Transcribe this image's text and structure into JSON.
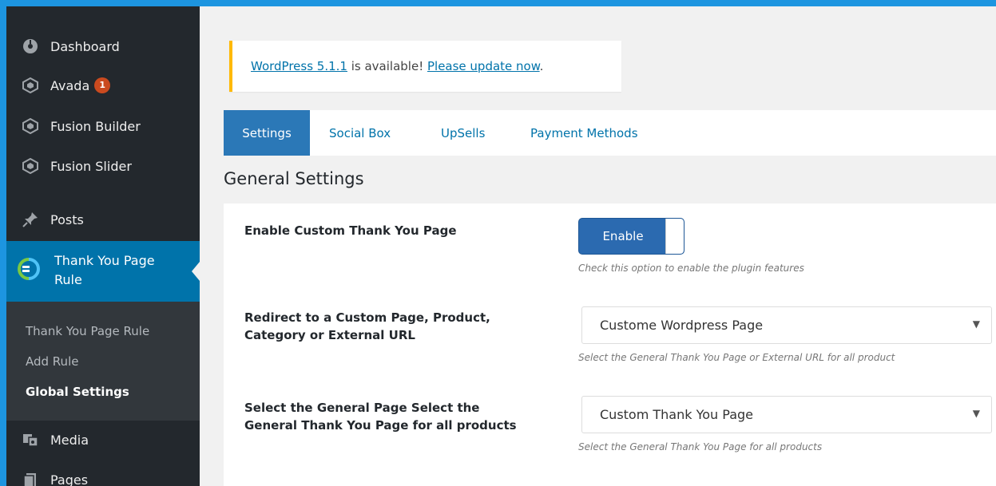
{
  "sidebar": {
    "items": [
      {
        "label": "Dashboard",
        "icon": "dashboard-icon"
      },
      {
        "label": "Avada",
        "icon": "avada-icon",
        "badge": "1"
      },
      {
        "label": "Fusion Builder",
        "icon": "fusion-builder-icon"
      },
      {
        "label": "Fusion Slider",
        "icon": "fusion-slider-icon"
      },
      {
        "label": "Posts",
        "icon": "pin-icon"
      }
    ],
    "active": {
      "label": "Thank You Page Rule",
      "icon": "thank-you-plugin-icon"
    },
    "submenu": [
      {
        "label": "Thank You Page Rule"
      },
      {
        "label": "Add Rule"
      },
      {
        "label": "Global Settings",
        "current": true
      }
    ],
    "lower_items": [
      {
        "label": "Media",
        "icon": "media-icon"
      },
      {
        "label": "Pages",
        "icon": "pages-icon"
      }
    ]
  },
  "notice": {
    "version_link": "WordPress 5.1.1",
    "middle": " is available! ",
    "update_link": "Please update now",
    "end": "."
  },
  "tabs": [
    {
      "label": "Settings",
      "active": true
    },
    {
      "label": "Social Box"
    },
    {
      "label": "UpSells"
    },
    {
      "label": "Payment Methods"
    }
  ],
  "section_title": "General Settings",
  "settings": {
    "enable": {
      "label": "Enable Custom Thank You Page",
      "toggle_label": "Enable",
      "hint": "Check this option to enable the plugin features"
    },
    "redirect": {
      "label": "Redirect to a Custom Page, Product, Category or External URL",
      "value": "Custome Wordpress Page",
      "hint": "Select the General Thank You Page or External URL for all product"
    },
    "general_page": {
      "label": "Select the General Page Select the General Thank You Page for all products",
      "value": "Custom Thank You Page",
      "hint": "Select the General Thank You Page for all products"
    }
  },
  "colors": {
    "frame": "#1d95e0",
    "sidebar": "#23282d",
    "active_menu": "#0073aa",
    "notice_border": "#ffb900",
    "tab_active": "#2b78b7"
  }
}
